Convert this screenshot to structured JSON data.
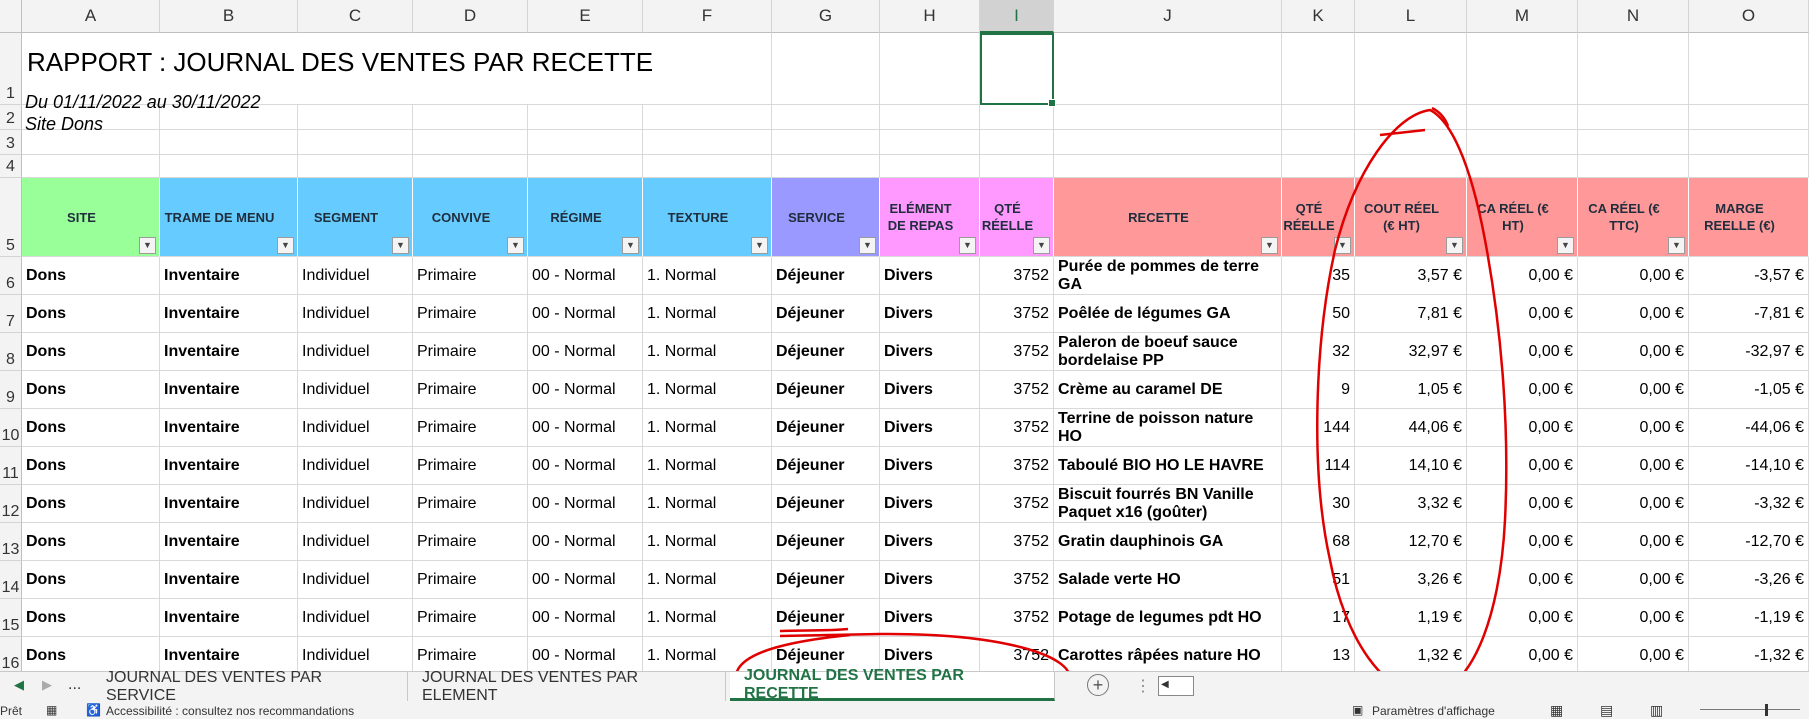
{
  "columns": [
    "A",
    "B",
    "C",
    "D",
    "E",
    "F",
    "G",
    "H",
    "I",
    "J",
    "K",
    "L",
    "M",
    "N",
    "O"
  ],
  "rows": [
    "1",
    "2",
    "3",
    "4",
    "5",
    "6",
    "7",
    "8",
    "9",
    "10",
    "11",
    "12",
    "13",
    "14",
    "15",
    "16"
  ],
  "report": {
    "title": "RAPPORT : JOURNAL DES VENTES PAR RECETTE",
    "period": "Du 01/11/2022 au 30/11/2022",
    "site": "Site Dons"
  },
  "headers": [
    {
      "label": "SITE",
      "color": "#99ff99",
      "filter": true
    },
    {
      "label": "TRAME DE MENU",
      "color": "#66ccff",
      "filter": true
    },
    {
      "label": "SEGMENT",
      "color": "#66ccff",
      "filter": true
    },
    {
      "label": "CONVIVE",
      "color": "#66ccff",
      "filter": true
    },
    {
      "label": "RÉGIME",
      "color": "#66ccff",
      "filter": true
    },
    {
      "label": "TEXTURE",
      "color": "#66ccff",
      "filter": true
    },
    {
      "label": "SERVICE",
      "color": "#9999ff",
      "filter": true
    },
    {
      "label": "ELÉMENT DE REPAS",
      "color": "#ff99ff",
      "filter": true
    },
    {
      "label": "QTÉ RÉELLE",
      "color": "#ff99ff",
      "filter": true
    },
    {
      "label": "RECETTE",
      "color": "#ff9999",
      "filter": true
    },
    {
      "label": "QTÉ RÉELLE",
      "color": "#ff9999",
      "filter": true
    },
    {
      "label": "COUT RÉEL (€ HT)",
      "color": "#ff9999",
      "filter": true
    },
    {
      "label": "CA RÉEL (€ HT)",
      "color": "#ff9999",
      "filter": true
    },
    {
      "label": "CA RÉEL (€ TTC)",
      "color": "#ff9999",
      "filter": true
    },
    {
      "label": "MARGE REELLE (€)",
      "color": "#ff9999",
      "filter": false
    }
  ],
  "data": [
    [
      "Dons",
      "Inventaire",
      "Individuel",
      "Primaire",
      "00 - Normal",
      "1. Normal",
      "Déjeuner",
      "Divers",
      "3752",
      "Purée de pommes de terre GA",
      "35",
      "3,57 €",
      "0,00 €",
      "0,00 €",
      "-3,57 €"
    ],
    [
      "Dons",
      "Inventaire",
      "Individuel",
      "Primaire",
      "00 - Normal",
      "1. Normal",
      "Déjeuner",
      "Divers",
      "3752",
      "Poêlée de légumes GA",
      "50",
      "7,81 €",
      "0,00 €",
      "0,00 €",
      "-7,81 €"
    ],
    [
      "Dons",
      "Inventaire",
      "Individuel",
      "Primaire",
      "00 - Normal",
      "1. Normal",
      "Déjeuner",
      "Divers",
      "3752",
      "Paleron de boeuf sauce bordelaise PP",
      "32",
      "32,97 €",
      "0,00 €",
      "0,00 €",
      "-32,97 €"
    ],
    [
      "Dons",
      "Inventaire",
      "Individuel",
      "Primaire",
      "00 - Normal",
      "1. Normal",
      "Déjeuner",
      "Divers",
      "3752",
      "Crème au caramel DE",
      "9",
      "1,05 €",
      "0,00 €",
      "0,00 €",
      "-1,05 €"
    ],
    [
      "Dons",
      "Inventaire",
      "Individuel",
      "Primaire",
      "00 - Normal",
      "1. Normal",
      "Déjeuner",
      "Divers",
      "3752",
      "Terrine de poisson nature HO",
      "144",
      "44,06 €",
      "0,00 €",
      "0,00 €",
      "-44,06 €"
    ],
    [
      "Dons",
      "Inventaire",
      "Individuel",
      "Primaire",
      "00 - Normal",
      "1. Normal",
      "Déjeuner",
      "Divers",
      "3752",
      "Taboulé BIO HO LE HAVRE",
      "114",
      "14,10 €",
      "0,00 €",
      "0,00 €",
      "-14,10 €"
    ],
    [
      "Dons",
      "Inventaire",
      "Individuel",
      "Primaire",
      "00 - Normal",
      "1. Normal",
      "Déjeuner",
      "Divers",
      "3752",
      "Biscuit fourrés BN Vanille Paquet x16 (goûter)",
      "30",
      "3,32 €",
      "0,00 €",
      "0,00 €",
      "-3,32 €"
    ],
    [
      "Dons",
      "Inventaire",
      "Individuel",
      "Primaire",
      "00 - Normal",
      "1. Normal",
      "Déjeuner",
      "Divers",
      "3752",
      "Gratin dauphinois GA",
      "68",
      "12,70 €",
      "0,00 €",
      "0,00 €",
      "-12,70 €"
    ],
    [
      "Dons",
      "Inventaire",
      "Individuel",
      "Primaire",
      "00 - Normal",
      "1. Normal",
      "Déjeuner",
      "Divers",
      "3752",
      "Salade verte HO",
      "51",
      "3,26 €",
      "0,00 €",
      "0,00 €",
      "-3,26 €"
    ],
    [
      "Dons",
      "Inventaire",
      "Individuel",
      "Primaire",
      "00 - Normal",
      "1. Normal",
      "Déjeuner",
      "Divers",
      "3752",
      "Potage de legumes pdt HO",
      "17",
      "1,19 €",
      "0,00 €",
      "0,00 €",
      "-1,19 €"
    ],
    [
      "Dons",
      "Inventaire",
      "Individuel",
      "Primaire",
      "00 - Normal",
      "1. Normal",
      "Déjeuner",
      "Divers",
      "3752",
      "Carottes râpées nature HO",
      "13",
      "1,32 €",
      "0,00 €",
      "0,00 €",
      "-1,32 €"
    ]
  ],
  "tabs": {
    "ellipsis": "...",
    "items": [
      {
        "label": "JOURNAL DES VENTES PAR SERVICE",
        "active": false
      },
      {
        "label": "JOURNAL DES VENTES PAR ELEMENT",
        "active": false
      },
      {
        "label": "JOURNAL DES VENTES PAR RECETTE",
        "active": true
      }
    ]
  },
  "status": {
    "ready": "Prêt",
    "accessibility": "Accessibilité : consultez nos recommandations",
    "display_settings": "Paramètres d'affichage"
  },
  "theme": {
    "excel_green": "#217346",
    "annotation_red": "#e00000"
  }
}
